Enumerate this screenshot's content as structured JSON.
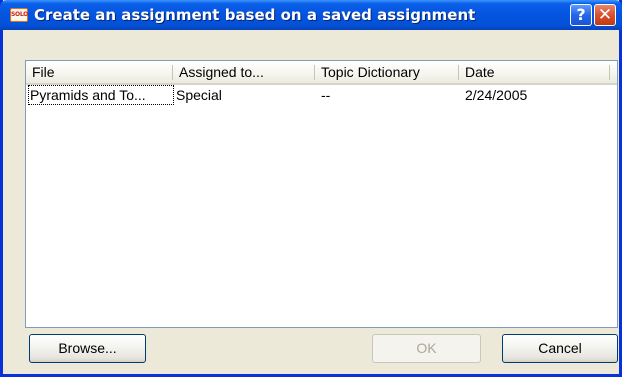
{
  "window": {
    "title": "Create an assignment based on a saved assignment",
    "icon_text": "SOLO",
    "help_glyph": "?",
    "close_glyph": "✕"
  },
  "list": {
    "columns": [
      "File",
      "Assigned to...",
      "Topic Dictionary",
      "Date"
    ],
    "rows": [
      {
        "file": "Pyramids and To...",
        "assigned_to": "Special",
        "topic_dictionary": "--",
        "date": "2/24/2005",
        "selected": true
      }
    ]
  },
  "buttons": {
    "browse": "Browse...",
    "ok": "OK",
    "ok_enabled": false,
    "cancel": "Cancel"
  }
}
